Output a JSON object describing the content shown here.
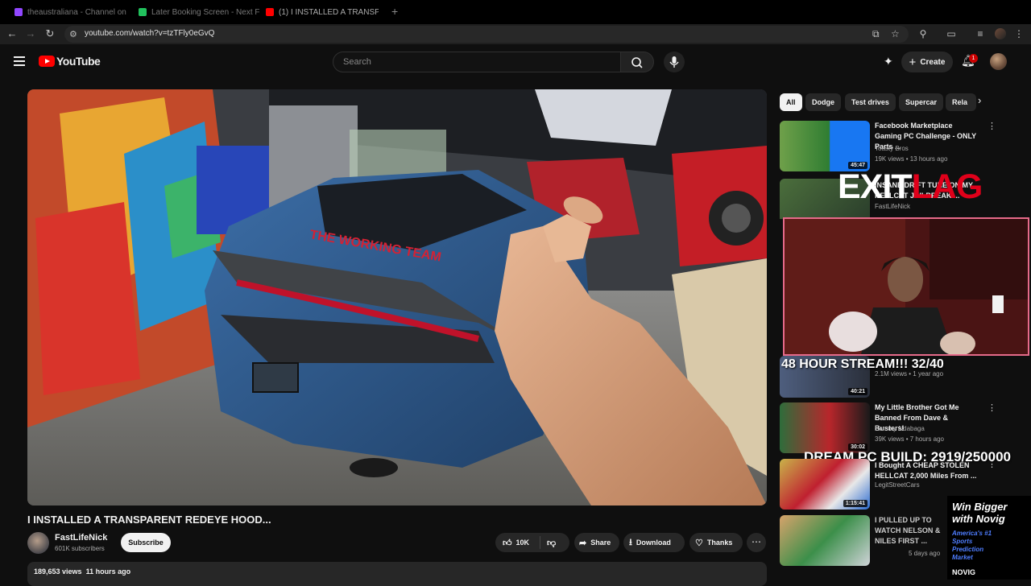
{
  "browser": {
    "tabs": [
      {
        "label": "theaustraliana - Channel on Tw...",
        "color": "#9147ff"
      },
      {
        "label": "Later Booking Screen - Next F...",
        "color": "#21c15d"
      },
      {
        "label": "(1) I INSTALLED A TRANSP...",
        "color": "#ff0000"
      }
    ],
    "new_tab": "+",
    "url": "youtube.com/watch?v=tzTFly0eGvQ"
  },
  "header": {
    "logo_text": "YouTube",
    "search_placeholder": "Search",
    "create_label": "Create",
    "notification_count": "1"
  },
  "video": {
    "title": "I INSTALLED A TRANSPARENT REDEYE HOOD...",
    "channel": "FastLifeNick",
    "subscribers": "601K subscribers",
    "subscribe_label": "Subscribe",
    "likes": "10K",
    "share_label": "Share",
    "download_label": "Download",
    "thanks_label": "Thanks",
    "views": "189,653 views",
    "posted": "11 hours ago"
  },
  "chips": [
    "All",
    "Dodge",
    "Test drives",
    "Supercar",
    "Rela"
  ],
  "recommendations": [
    {
      "title": "Facebook Marketplace Gaming PC Challenge - ONLY Parts ...",
      "channel": "Toasty Bros",
      "views": "19K views",
      "age": "13 hours ago",
      "duration": "45:47"
    },
    {
      "title": "INSANE DRIFT TUNE ON MY HELLCAT JAILBREAK ...",
      "channel": "FastLifeNick",
      "views": "",
      "age": "",
      "duration": ""
    },
    {
      "title": "48 HOUR STREAM!!! 32/40",
      "channel": "",
      "views": "2.1M views",
      "age": "1 year ago",
      "duration": "40:21"
    },
    {
      "title": "My Little Brother Got Me Banned From Dave & Busters!",
      "channel": "Sammy Ndabaga",
      "views": "39K views",
      "age": "7 hours ago",
      "duration": "30:02"
    },
    {
      "title": "I Bought A CHEAP STOLEN HELLCAT 2,000 Miles From ...",
      "channel": "LegitStreetCars",
      "views": "",
      "age": "",
      "duration": "1:15:41"
    },
    {
      "title": "I PULLED UP TO WATCH NELSON & NILES FIRST ...",
      "channel": "",
      "views": "",
      "age": "5 days ago",
      "duration": ""
    }
  ],
  "overlays": {
    "logo_white": "EXIT",
    "logo_red": "LAG",
    "stream_goal": "DREAM PC BUILD: 2919/250000",
    "ad_headline_1": "Win Bigger",
    "ad_headline_2": "with Novig",
    "ad_sub": "America's #1 Sports Prediction Market",
    "ad_brand": "NOVIG"
  },
  "colors": {
    "background": "#0f0f0f",
    "yt_red": "#ff0000",
    "chip_bg": "#272727"
  }
}
